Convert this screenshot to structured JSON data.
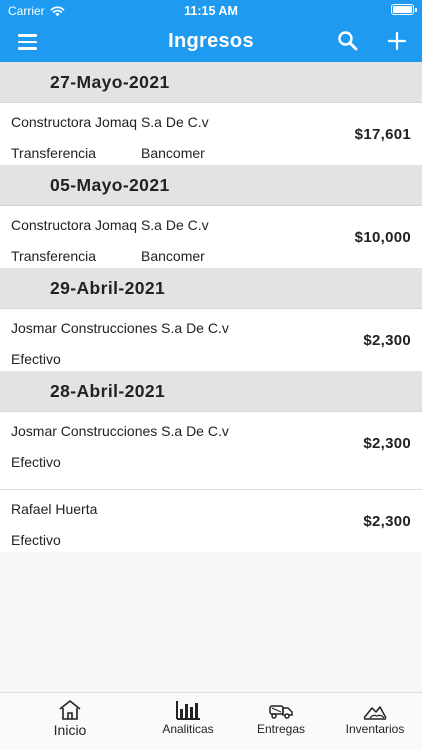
{
  "status": {
    "carrier": "Carrier",
    "time": "11:15 AM"
  },
  "appbar": {
    "title": "Ingresos"
  },
  "groups": [
    {
      "date": "27-Mayo-2021",
      "entries": [
        {
          "company": "Constructora Jomaq S.a De C.v",
          "method": "Transferencia",
          "bank": "Bancomer",
          "amount": "$17,601"
        }
      ]
    },
    {
      "date": "05-Mayo-2021",
      "entries": [
        {
          "company": "Constructora Jomaq S.a De C.v",
          "method": "Transferencia",
          "bank": "Bancomer",
          "amount": "$10,000"
        }
      ]
    },
    {
      "date": "29-Abril-2021",
      "entries": [
        {
          "company": "Josmar Construcciones S.a De C.v",
          "method": "Efectivo",
          "bank": "",
          "amount": "$2,300"
        }
      ]
    },
    {
      "date": "28-Abril-2021",
      "entries": [
        {
          "company": "Josmar Construcciones S.a De C.v",
          "method": "Efectivo",
          "bank": "",
          "amount": "$2,300"
        },
        {
          "company": "Rafael Huerta",
          "method": "Efectivo",
          "bank": "",
          "amount": "$2,300"
        }
      ]
    }
  ],
  "tabs": [
    {
      "label": "Inicio",
      "icon": "home-icon"
    },
    {
      "label": "Analiticas",
      "icon": "bar-chart-icon"
    },
    {
      "label": "Entregas",
      "icon": "truck-icon"
    },
    {
      "label": "Inventarios",
      "icon": "mountain-icon"
    }
  ]
}
